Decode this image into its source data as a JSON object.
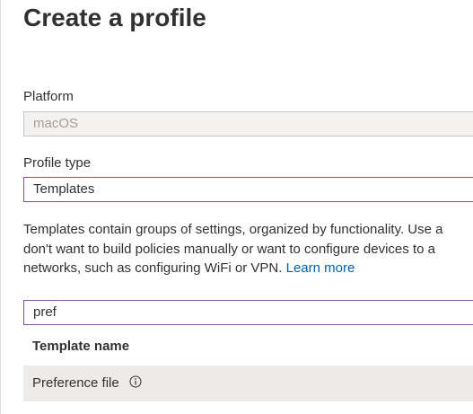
{
  "page": {
    "title": "Create a profile"
  },
  "platform": {
    "label": "Platform",
    "value": "macOS"
  },
  "profile_type": {
    "label": "Profile type",
    "value": "Templates"
  },
  "description": {
    "line1": "Templates contain groups of settings, organized by functionality. Use a",
    "line2": "don't want to build policies manually or want to configure devices to a",
    "line3": "networks, such as configuring WiFi or VPN.",
    "link": "Learn more"
  },
  "search": {
    "value": "pref"
  },
  "table": {
    "header": "Template name",
    "rows": [
      {
        "name": "Preference file"
      }
    ]
  },
  "colors": {
    "active_border": "#8a4fa8",
    "link": "#0062ad",
    "row_bg": "#edebe9"
  },
  "icons": {
    "row_info": "info-icon"
  }
}
